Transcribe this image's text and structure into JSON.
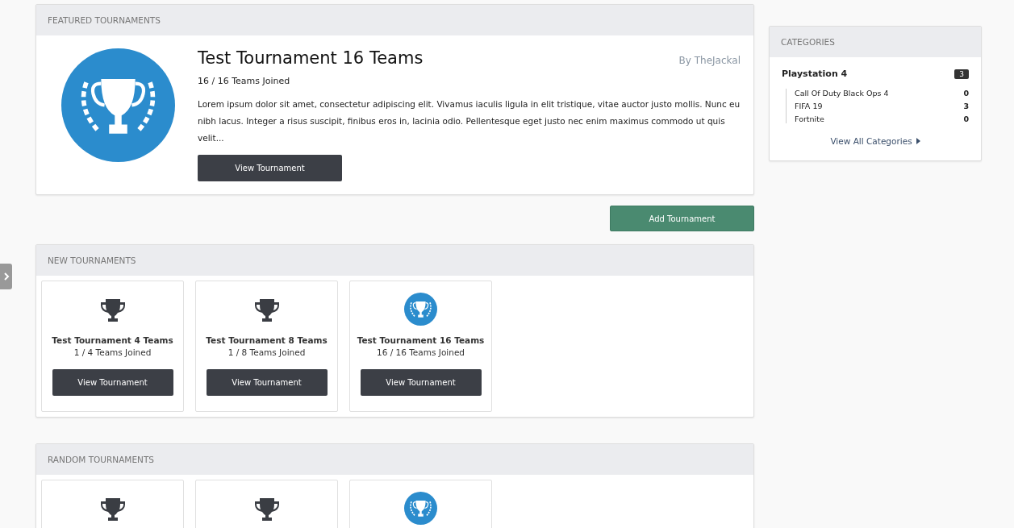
{
  "featured": {
    "heading": "FEATURED TOURNAMENTS",
    "title": "Test Tournament 16 Teams",
    "author": "By TheJackal",
    "joined": "16 / 16 Teams Joined",
    "description": "Lorem ipsum dolor sit amet, consectetur adipiscing elit. Vivamus iaculis ligula in elit tristique, vitae auctor justo mollis. Nunc eu nibh lacus. Integer a risus suscipit, finibus eros in, lacinia odio. Pellentesque eget justo nec enim maximus commodo ut quis velit...",
    "button": "View Tournament"
  },
  "add_button": "Add Tournament",
  "new_tournaments": {
    "heading": "NEW TOURNAMENTS",
    "cards": [
      {
        "kind": "trophy",
        "title": "Test Tournament 4 Teams",
        "joined": "1 / 4 Teams Joined",
        "button": "View Tournament"
      },
      {
        "kind": "trophy",
        "title": "Test Tournament 8 Teams",
        "joined": "1 / 8 Teams Joined",
        "button": "View Tournament"
      },
      {
        "kind": "logo",
        "title": "Test Tournament 16 Teams",
        "joined": "16 / 16 Teams Joined",
        "button": "View Tournament"
      }
    ]
  },
  "random_tournaments": {
    "heading": "RANDOM TOURNAMENTS",
    "cards": [
      {
        "kind": "trophy"
      },
      {
        "kind": "trophy"
      },
      {
        "kind": "logo"
      }
    ]
  },
  "categories": {
    "heading": "CATEGORIES",
    "group": {
      "name": "Playstation 4",
      "count": "3",
      "items": [
        {
          "name": "Call Of Duty Black Ops 4",
          "count": "0"
        },
        {
          "name": "FIFA 19",
          "count": "3"
        },
        {
          "name": "Fortnite",
          "count": "0"
        }
      ]
    },
    "link": "View All Categories"
  }
}
